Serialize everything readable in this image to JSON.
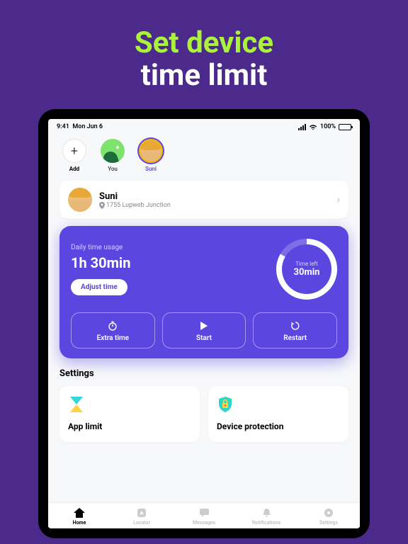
{
  "hero": {
    "line1": "Set device",
    "line2": "time limit"
  },
  "status": {
    "time": "9:41",
    "date": "Mon Jun 6",
    "battery": "100%"
  },
  "profiles": {
    "add_label": "Add",
    "items": [
      {
        "label": "You"
      },
      {
        "label": "Suni"
      }
    ]
  },
  "profile_card": {
    "name": "Suni",
    "location": "1755 Lupweb Junction"
  },
  "time_card": {
    "usage_label": "Daily time usage",
    "usage_value": "1h  30min",
    "adjust_label": "Adjust time",
    "ring_label": "Time left",
    "ring_value": "30min",
    "actions": [
      {
        "label": "Extra time"
      },
      {
        "label": "Start"
      },
      {
        "label": "Restart"
      }
    ]
  },
  "settings": {
    "title": "Settings",
    "cards": [
      {
        "label": "App limit"
      },
      {
        "label": "Device protection"
      }
    ]
  },
  "tabs": [
    {
      "label": "Home"
    },
    {
      "label": "Locator"
    },
    {
      "label": "Messages"
    },
    {
      "label": "Notifications"
    },
    {
      "label": "Settings"
    }
  ]
}
